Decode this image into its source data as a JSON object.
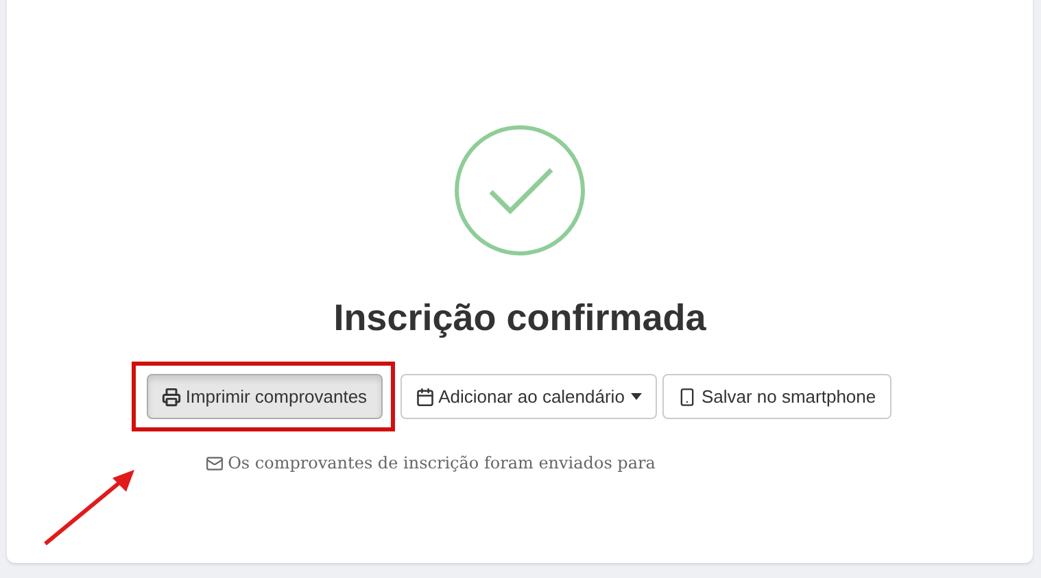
{
  "status": {
    "title": "Inscrição confirmada"
  },
  "actions": [
    {
      "kind": "print",
      "label": "Imprimir comprovantes",
      "pressed": true,
      "dropdown": false
    },
    {
      "kind": "calendar",
      "label": "Adicionar ao calendário",
      "pressed": false,
      "dropdown": true
    },
    {
      "kind": "phone",
      "label": "Salvar no smartphone",
      "pressed": false,
      "dropdown": false
    }
  ],
  "notice": {
    "text": "Os comprovantes de inscrição foram enviados para"
  }
}
